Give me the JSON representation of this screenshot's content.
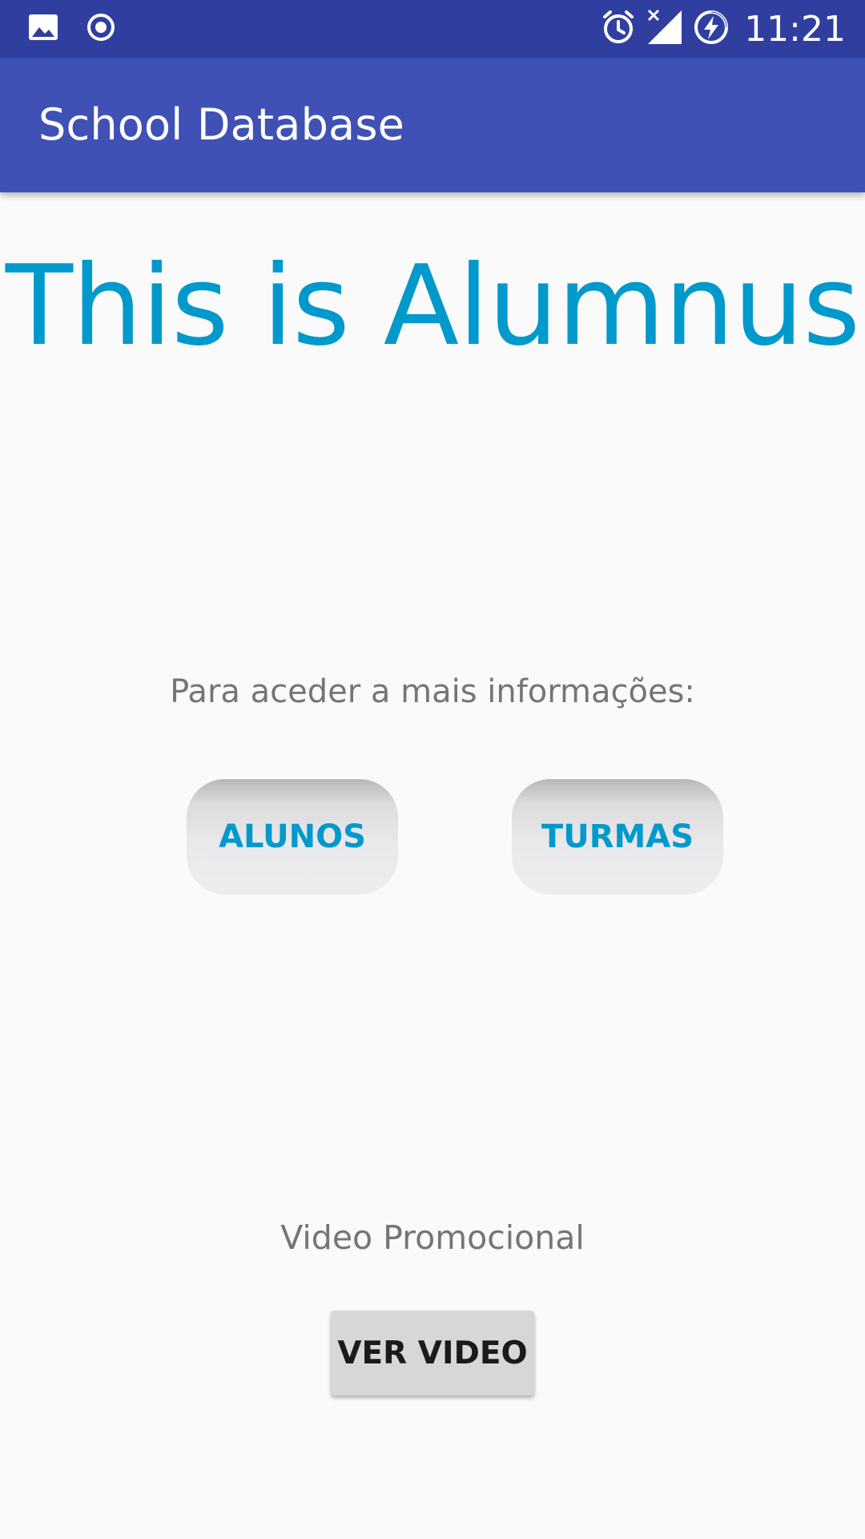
{
  "status_bar": {
    "time": "11:21",
    "left_icons": [
      "image-icon",
      "record-icon"
    ],
    "right_icons": [
      "alarm-icon",
      "signal-off-icon",
      "battery-charging-icon"
    ]
  },
  "app_bar": {
    "title": "School Database",
    "color": "#3f51b5"
  },
  "main": {
    "headline": "This is Alumnus",
    "info_label": "Para aceder a mais informações:",
    "buttons": {
      "alunos": "ALUNOS",
      "turmas": "TURMAS"
    },
    "video_label": "Video Promocional",
    "video_button": "VER VIDEO"
  },
  "colors": {
    "status_bar": "#303f9f",
    "accent": "#0099cc",
    "background": "#fafafa"
  }
}
